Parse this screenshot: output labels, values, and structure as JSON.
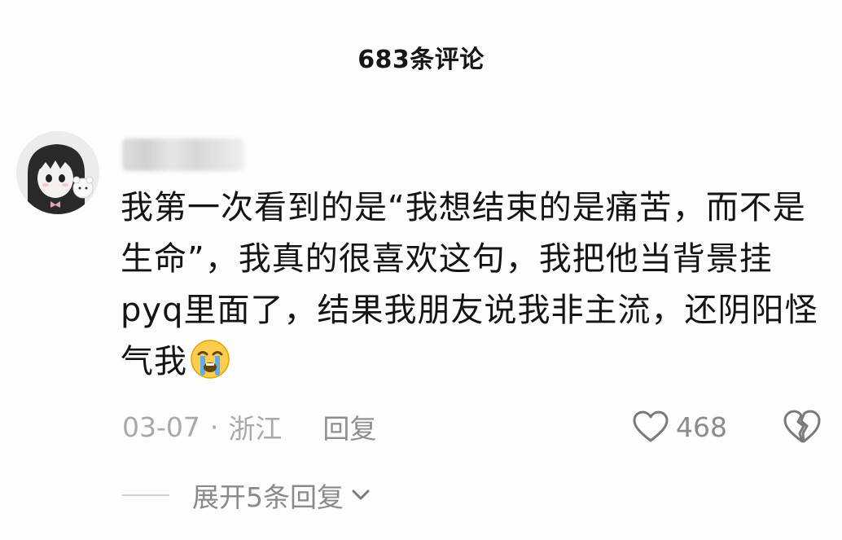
{
  "header": {
    "title": "683条评论"
  },
  "comment": {
    "avatar_icon": "avatar-anime-girl",
    "text": "我第一次看到的是“我想结束的是痛苦，而不是生命”，我真的很喜欢这句，我把他当背景挂pyq里面了，结果我朋友说我非主流，还阴阳怪气我",
    "emoji_icon": "loudly-crying-face-icon",
    "date": "03-07",
    "separator": "·",
    "location": "浙江",
    "reply_label": "回复",
    "like_count": "468",
    "like_icon": "heart-outline-icon",
    "dislike_icon": "broken-heart-icon"
  },
  "replies": {
    "expand_label": "展开5条回复",
    "expand_icon": "chevron-down-icon"
  }
}
